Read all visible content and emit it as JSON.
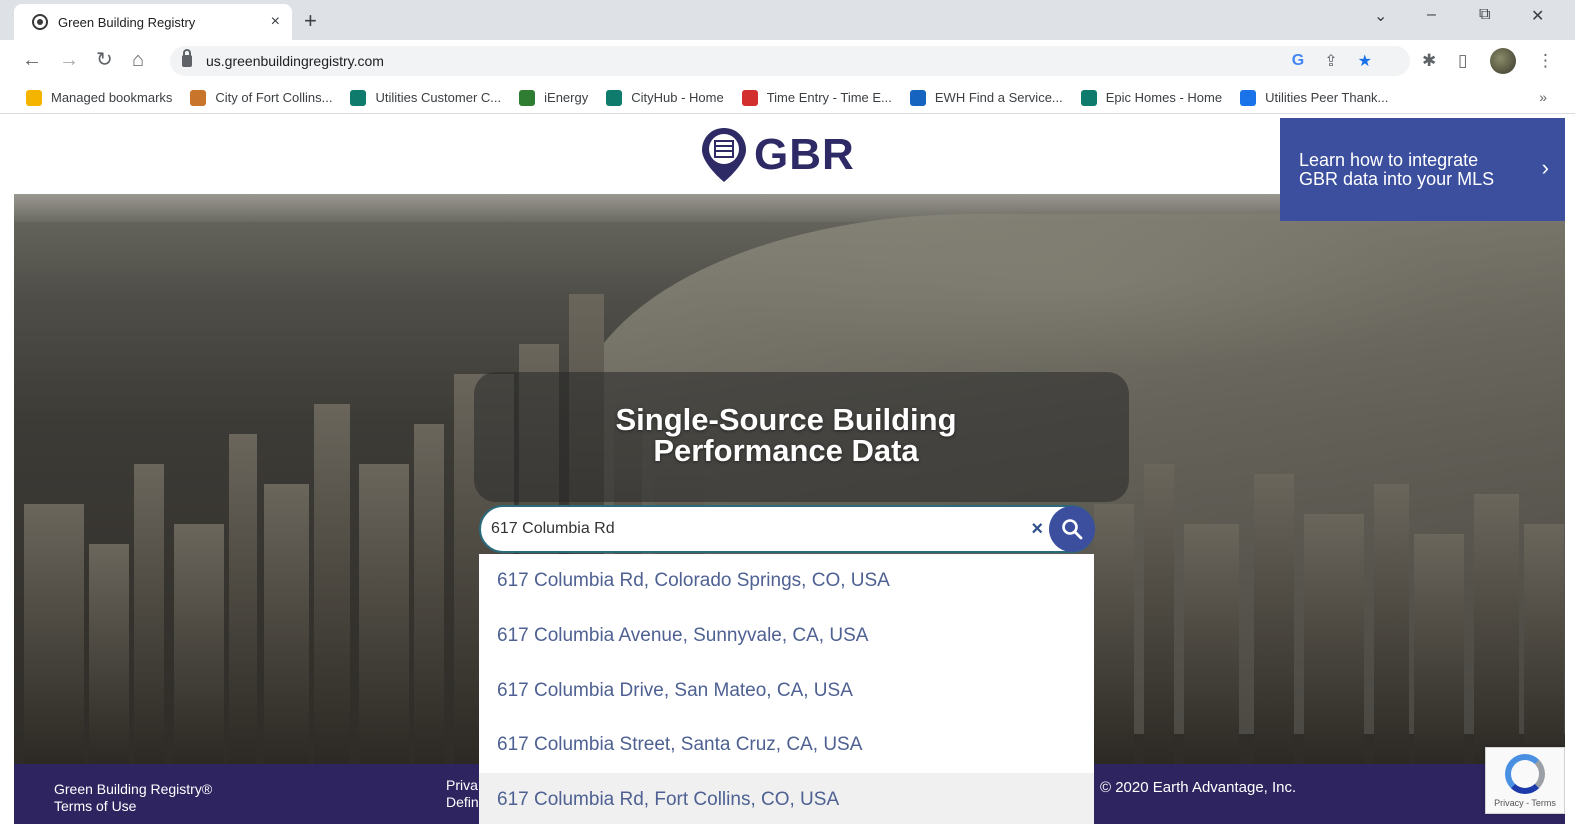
{
  "browser": {
    "tab_title": "Green Building Registry",
    "tab_close": "×",
    "new_tab": "+",
    "url": "us.greenbuildingregistry.com",
    "nav": {
      "back": "←",
      "forward": "→",
      "reload": "↻",
      "home": "⌂"
    },
    "window": {
      "dropdown": "⌄",
      "minimize": "–",
      "restore": "⧉",
      "close": "✕"
    },
    "bookmarks": [
      {
        "label": "Managed bookmarks",
        "color": "#f4b400"
      },
      {
        "label": "City of Fort Collins...",
        "color": "#c8742a"
      },
      {
        "label": "Utilities Customer C...",
        "color": "#0f7b6c"
      },
      {
        "label": "iEnergy",
        "color": "#2e7d32"
      },
      {
        "label": "CityHub - Home",
        "color": "#0f7b6c"
      },
      {
        "label": "Time Entry - Time E...",
        "color": "#d32f2f"
      },
      {
        "label": "EWH Find a Service...",
        "color": "#1565c0"
      },
      {
        "label": "Epic Homes - Home",
        "color": "#0f7b6c"
      },
      {
        "label": "Utilities Peer Thank...",
        "color": "#1a73e8"
      }
    ],
    "bookmarks_more": "»"
  },
  "site": {
    "logo_text": "GBR",
    "promo": {
      "line1": "Learn how to integrate",
      "line2": "GBR data into your MLS",
      "chevron": "›"
    },
    "hero_title_line1": "Single-Source Building",
    "hero_title_line2": "Performance Data",
    "search": {
      "value": "617 Columbia Rd",
      "clear": "×"
    },
    "suggestions": [
      "617 Columbia Rd, Colorado Springs, CO, USA",
      "617 Columbia Avenue, Sunnyvale, CA, USA",
      "617 Columbia Drive, San Mateo, CA, USA",
      "617 Columbia Street, Santa Cruz, CA, USA",
      "617 Columbia Rd, Fort Collins, CO, USA"
    ],
    "footer": {
      "brand": "Green Building Registry®",
      "terms": "Terms of Use",
      "privacy_partial": "Priva",
      "definitions_partial": "Defin",
      "copyright": "© 2020 Earth Advantage, Inc."
    },
    "recaptcha_text": "Privacy - Terms"
  },
  "colors": {
    "brand_navy": "#2e2560",
    "brand_blue": "#3b4f9e",
    "suggestion_text": "#4e6192"
  }
}
